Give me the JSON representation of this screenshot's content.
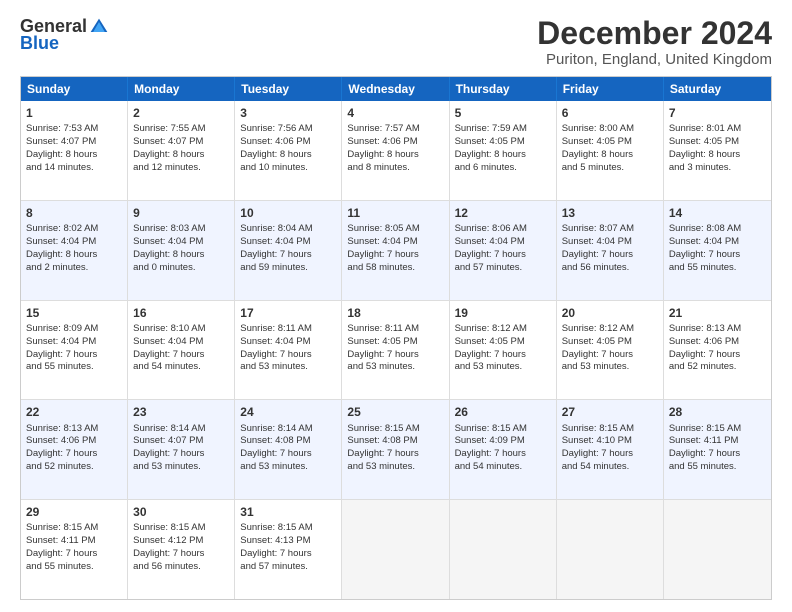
{
  "header": {
    "logo_general": "General",
    "logo_blue": "Blue",
    "month_title": "December 2024",
    "location": "Puriton, England, United Kingdom"
  },
  "days_of_week": [
    "Sunday",
    "Monday",
    "Tuesday",
    "Wednesday",
    "Thursday",
    "Friday",
    "Saturday"
  ],
  "rows": [
    [
      {
        "day": "1",
        "lines": [
          "Sunrise: 7:53 AM",
          "Sunset: 4:07 PM",
          "Daylight: 8 hours",
          "and 14 minutes."
        ]
      },
      {
        "day": "2",
        "lines": [
          "Sunrise: 7:55 AM",
          "Sunset: 4:07 PM",
          "Daylight: 8 hours",
          "and 12 minutes."
        ]
      },
      {
        "day": "3",
        "lines": [
          "Sunrise: 7:56 AM",
          "Sunset: 4:06 PM",
          "Daylight: 8 hours",
          "and 10 minutes."
        ]
      },
      {
        "day": "4",
        "lines": [
          "Sunrise: 7:57 AM",
          "Sunset: 4:06 PM",
          "Daylight: 8 hours",
          "and 8 minutes."
        ]
      },
      {
        "day": "5",
        "lines": [
          "Sunrise: 7:59 AM",
          "Sunset: 4:05 PM",
          "Daylight: 8 hours",
          "and 6 minutes."
        ]
      },
      {
        "day": "6",
        "lines": [
          "Sunrise: 8:00 AM",
          "Sunset: 4:05 PM",
          "Daylight: 8 hours",
          "and 5 minutes."
        ]
      },
      {
        "day": "7",
        "lines": [
          "Sunrise: 8:01 AM",
          "Sunset: 4:05 PM",
          "Daylight: 8 hours",
          "and 3 minutes."
        ]
      }
    ],
    [
      {
        "day": "8",
        "lines": [
          "Sunrise: 8:02 AM",
          "Sunset: 4:04 PM",
          "Daylight: 8 hours",
          "and 2 minutes."
        ]
      },
      {
        "day": "9",
        "lines": [
          "Sunrise: 8:03 AM",
          "Sunset: 4:04 PM",
          "Daylight: 8 hours",
          "and 0 minutes."
        ]
      },
      {
        "day": "10",
        "lines": [
          "Sunrise: 8:04 AM",
          "Sunset: 4:04 PM",
          "Daylight: 7 hours",
          "and 59 minutes."
        ]
      },
      {
        "day": "11",
        "lines": [
          "Sunrise: 8:05 AM",
          "Sunset: 4:04 PM",
          "Daylight: 7 hours",
          "and 58 minutes."
        ]
      },
      {
        "day": "12",
        "lines": [
          "Sunrise: 8:06 AM",
          "Sunset: 4:04 PM",
          "Daylight: 7 hours",
          "and 57 minutes."
        ]
      },
      {
        "day": "13",
        "lines": [
          "Sunrise: 8:07 AM",
          "Sunset: 4:04 PM",
          "Daylight: 7 hours",
          "and 56 minutes."
        ]
      },
      {
        "day": "14",
        "lines": [
          "Sunrise: 8:08 AM",
          "Sunset: 4:04 PM",
          "Daylight: 7 hours",
          "and 55 minutes."
        ]
      }
    ],
    [
      {
        "day": "15",
        "lines": [
          "Sunrise: 8:09 AM",
          "Sunset: 4:04 PM",
          "Daylight: 7 hours",
          "and 55 minutes."
        ]
      },
      {
        "day": "16",
        "lines": [
          "Sunrise: 8:10 AM",
          "Sunset: 4:04 PM",
          "Daylight: 7 hours",
          "and 54 minutes."
        ]
      },
      {
        "day": "17",
        "lines": [
          "Sunrise: 8:11 AM",
          "Sunset: 4:04 PM",
          "Daylight: 7 hours",
          "and 53 minutes."
        ]
      },
      {
        "day": "18",
        "lines": [
          "Sunrise: 8:11 AM",
          "Sunset: 4:05 PM",
          "Daylight: 7 hours",
          "and 53 minutes."
        ]
      },
      {
        "day": "19",
        "lines": [
          "Sunrise: 8:12 AM",
          "Sunset: 4:05 PM",
          "Daylight: 7 hours",
          "and 53 minutes."
        ]
      },
      {
        "day": "20",
        "lines": [
          "Sunrise: 8:12 AM",
          "Sunset: 4:05 PM",
          "Daylight: 7 hours",
          "and 53 minutes."
        ]
      },
      {
        "day": "21",
        "lines": [
          "Sunrise: 8:13 AM",
          "Sunset: 4:06 PM",
          "Daylight: 7 hours",
          "and 52 minutes."
        ]
      }
    ],
    [
      {
        "day": "22",
        "lines": [
          "Sunrise: 8:13 AM",
          "Sunset: 4:06 PM",
          "Daylight: 7 hours",
          "and 52 minutes."
        ]
      },
      {
        "day": "23",
        "lines": [
          "Sunrise: 8:14 AM",
          "Sunset: 4:07 PM",
          "Daylight: 7 hours",
          "and 53 minutes."
        ]
      },
      {
        "day": "24",
        "lines": [
          "Sunrise: 8:14 AM",
          "Sunset: 4:08 PM",
          "Daylight: 7 hours",
          "and 53 minutes."
        ]
      },
      {
        "day": "25",
        "lines": [
          "Sunrise: 8:15 AM",
          "Sunset: 4:08 PM",
          "Daylight: 7 hours",
          "and 53 minutes."
        ]
      },
      {
        "day": "26",
        "lines": [
          "Sunrise: 8:15 AM",
          "Sunset: 4:09 PM",
          "Daylight: 7 hours",
          "and 54 minutes."
        ]
      },
      {
        "day": "27",
        "lines": [
          "Sunrise: 8:15 AM",
          "Sunset: 4:10 PM",
          "Daylight: 7 hours",
          "and 54 minutes."
        ]
      },
      {
        "day": "28",
        "lines": [
          "Sunrise: 8:15 AM",
          "Sunset: 4:11 PM",
          "Daylight: 7 hours",
          "and 55 minutes."
        ]
      }
    ],
    [
      {
        "day": "29",
        "lines": [
          "Sunrise: 8:15 AM",
          "Sunset: 4:11 PM",
          "Daylight: 7 hours",
          "and 55 minutes."
        ]
      },
      {
        "day": "30",
        "lines": [
          "Sunrise: 8:15 AM",
          "Sunset: 4:12 PM",
          "Daylight: 7 hours",
          "and 56 minutes."
        ]
      },
      {
        "day": "31",
        "lines": [
          "Sunrise: 8:15 AM",
          "Sunset: 4:13 PM",
          "Daylight: 7 hours",
          "and 57 minutes."
        ]
      },
      {
        "day": "",
        "lines": []
      },
      {
        "day": "",
        "lines": []
      },
      {
        "day": "",
        "lines": []
      },
      {
        "day": "",
        "lines": []
      }
    ]
  ]
}
